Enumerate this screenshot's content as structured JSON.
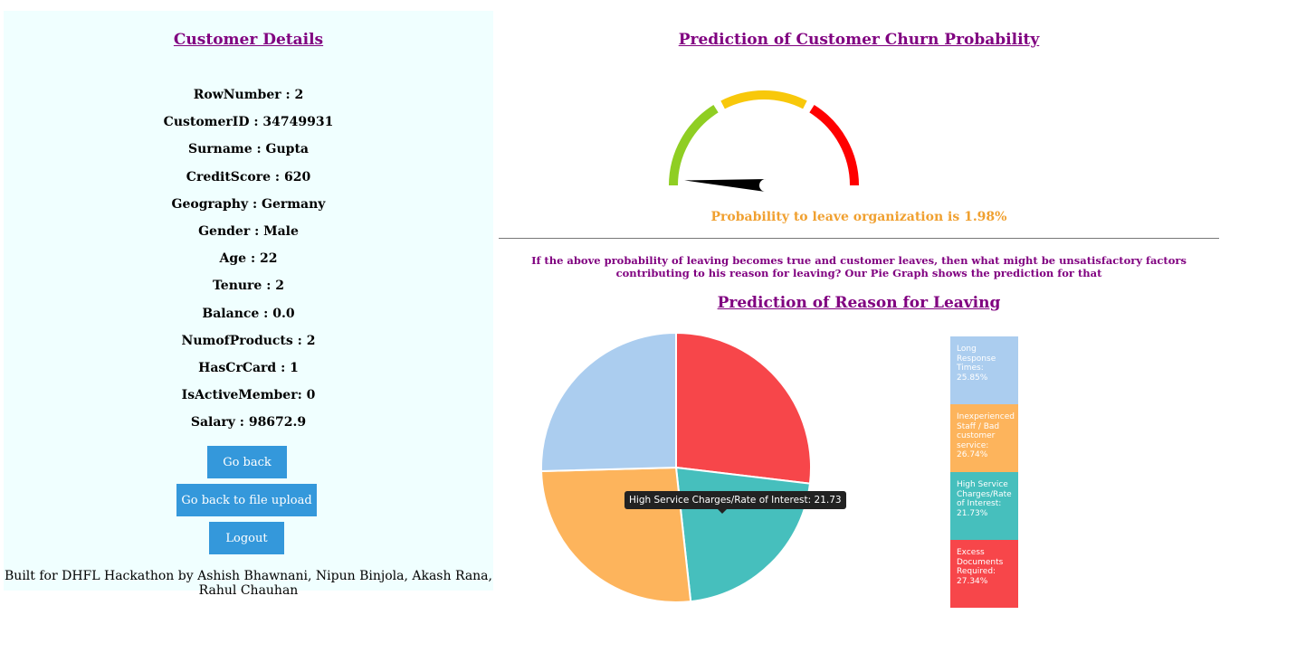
{
  "customer_panel": {
    "title": "Customer Details",
    "details": [
      "RowNumber : 2",
      "CustomerID : 34749931",
      "Surname : Gupta",
      "CreditScore : 620",
      "Geography : Germany",
      "Gender : Male",
      "Age : 22",
      "Tenure : 2",
      "Balance : 0.0",
      "NumofProducts : 2",
      "HasCrCard : 1",
      "IsActiveMember: 0",
      "Salary : 98672.9"
    ],
    "buttons": {
      "go_back": "Go back",
      "go_back_upload": "Go back to file upload",
      "logout": "Logout"
    },
    "footer": "Built for DHFL Hackathon by Ashish Bhawnani, Nipun Binjola, Akash Rana, Rahul Chauhan"
  },
  "churn": {
    "title": "Prediction of Customer Churn Probability",
    "probability_percent": 1.98,
    "probability_text": "Probability to leave organization is 1.98%",
    "gauge_colors": [
      "#8fce23",
      "#f8c80a",
      "#ff0000"
    ]
  },
  "question": "If the above probability of leaving becomes true and customer leaves, then what might be unsatisfactory factors contributing to his reason for leaving? Our Pie Graph shows the prediction for that",
  "reasons_title": "Prediction of Reason for Leaving",
  "chart_data": {
    "type": "pie",
    "slices": [
      {
        "name": "Excess Documents Required",
        "value": 27.34,
        "color": "#f7464a"
      },
      {
        "name": "High Service Charges/Rate of Interest",
        "value": 21.73,
        "color": "#46bfbd"
      },
      {
        "name": "Inexperienced Staff / Bad customer service",
        "value": 26.74,
        "color": "#fdb45c"
      },
      {
        "name": "Long Response Times",
        "value": 25.85,
        "color": "#abcdef"
      }
    ],
    "legend": [
      {
        "text": "Long Response Times: 25.85%",
        "color": "#abcdef"
      },
      {
        "text": "Inexperienced Staff / Bad customer service: 26.74%",
        "color": "#fdb45c"
      },
      {
        "text": "High Service Charges/Rate of Interest: 21.73%",
        "color": "#46bfbd"
      },
      {
        "text": "Excess Documents Required: 27.34%",
        "color": "#f7464a"
      }
    ],
    "tooltip": "High Service Charges/Rate of Interest: 21.73",
    "legend_placement": "right"
  }
}
